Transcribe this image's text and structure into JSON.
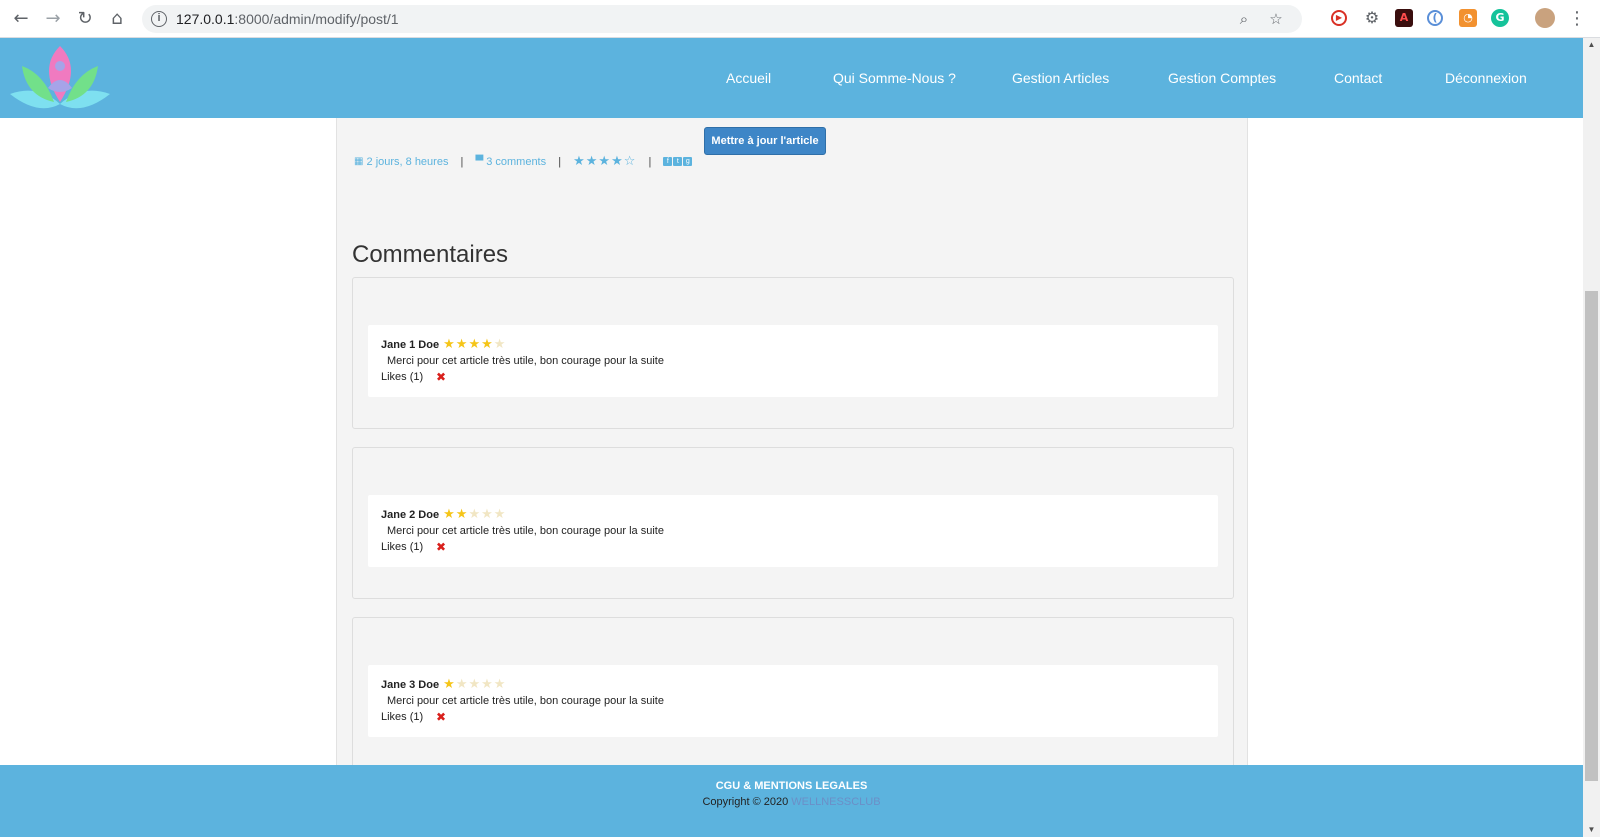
{
  "browser": {
    "url_host": "127.0.0.1",
    "url_path": ":8000/admin/modify/post/1"
  },
  "nav": {
    "items": [
      "Accueil",
      "Qui Somme-Nous ?",
      "Gestion Articles",
      "Gestion Comptes",
      "Contact",
      "Déconnexion"
    ]
  },
  "article": {
    "update_button": "Mettre à jour l'article",
    "date": "2 jours, 8 heures",
    "comments_link": "3 comments",
    "rating_stars": "★★★★☆",
    "separator": "|"
  },
  "comments": {
    "title": "Commentaires",
    "items": [
      {
        "author": "Jane 1 Doe",
        "stars_on": "★★★★",
        "stars_off": "★",
        "rating": 4,
        "text": "Merci pour cet article très utile, bon courage pour la suite",
        "likes": "Likes (1)"
      },
      {
        "author": "Jane 2 Doe",
        "stars_on": "★★",
        "stars_off": "★★★",
        "rating": 2,
        "text": "Merci pour cet article très utile, bon courage pour la suite",
        "likes": "Likes (1)"
      },
      {
        "author": "Jane 3 Doe",
        "stars_on": "★",
        "stars_off": "★★★★",
        "rating": 1,
        "text": "Merci pour cet article très utile, bon courage pour la suite",
        "likes": "Likes (1)"
      }
    ]
  },
  "footer": {
    "cgu": "CGU & MENTIONS LEGALES",
    "copyright": "Copyright © 2020",
    "brand": "WELLNESSCLUB"
  },
  "colors": {
    "header": "#5cb3de",
    "button": "#3e86c7",
    "star_on": "#f5c518",
    "delete": "#d9201c"
  }
}
